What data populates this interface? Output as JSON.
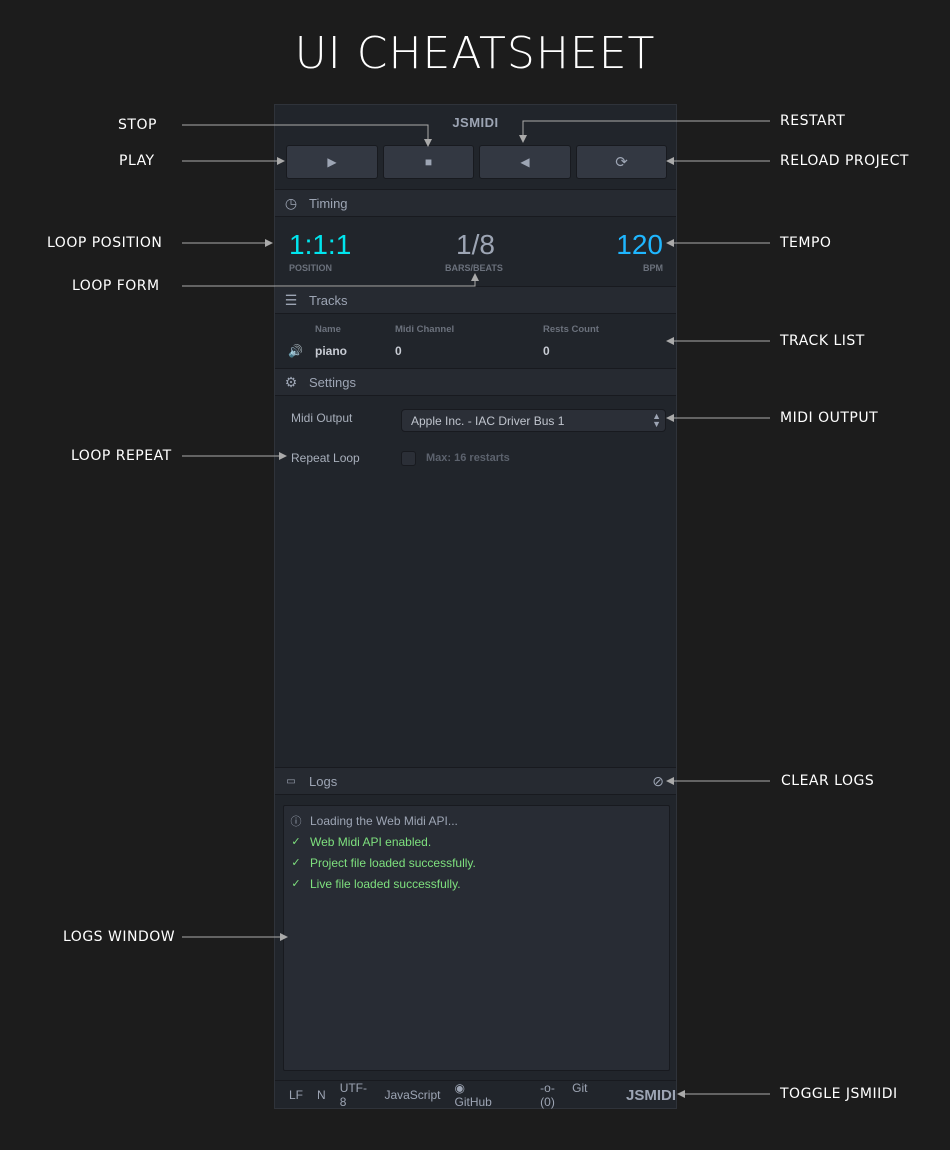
{
  "title": "UI CHEATSHEET",
  "annotations": {
    "stop": "STOP",
    "restart": "RESTART",
    "play": "PLAY",
    "reload": "RELOAD PROJECT",
    "loop_position": "LOOP POSITION",
    "tempo": "TEMPO",
    "loop_form": "LOOP FORM",
    "track_list": "TRACK LIST",
    "midi_output": "MIDI OUTPUT",
    "loop_repeat": "LOOP REPEAT",
    "clear_logs": "CLEAR LOGS",
    "logs_window": "LOGS WINDOW",
    "toggle": "TOGGLE JSMIIDI"
  },
  "app": {
    "logo": "JSMIDI"
  },
  "timing": {
    "header": "Timing",
    "position": "1:1:1",
    "position_label": "POSITION",
    "form": "1/8",
    "form_label": "BARS/BEATS",
    "tempo": "120",
    "tempo_label": "BPM"
  },
  "tracks": {
    "header": "Tracks",
    "columns": [
      "Name",
      "Midi Channel",
      "Rests Count"
    ],
    "rows": [
      {
        "name": "piano",
        "channel": "0",
        "rests": "0"
      }
    ]
  },
  "settings": {
    "header": "Settings",
    "midi_output_label": "Midi Output",
    "midi_output_value": "Apple Inc. - IAC Driver Bus 1",
    "repeat_label": "Repeat Loop",
    "repeat_hint": "Max: 16 restarts"
  },
  "logs": {
    "header": "Logs",
    "entries": [
      {
        "text": "Loading the Web Midi API...",
        "type": "info"
      },
      {
        "text": "Web Midi API enabled.",
        "type": "success"
      },
      {
        "text": "Project file loaded successfully.",
        "type": "success"
      },
      {
        "text": "Live file loaded successfully.",
        "type": "success"
      }
    ]
  },
  "statusbar": {
    "eol": "LF",
    "n": "N",
    "encoding": "UTF-8",
    "language": "JavaScript",
    "github": "GitHub",
    "git": "Git (0)",
    "logo": "JSMIDI"
  },
  "colors": {
    "position": "#00e5ee",
    "tempo": "#1fb6ff",
    "success": "#7ee07e"
  }
}
